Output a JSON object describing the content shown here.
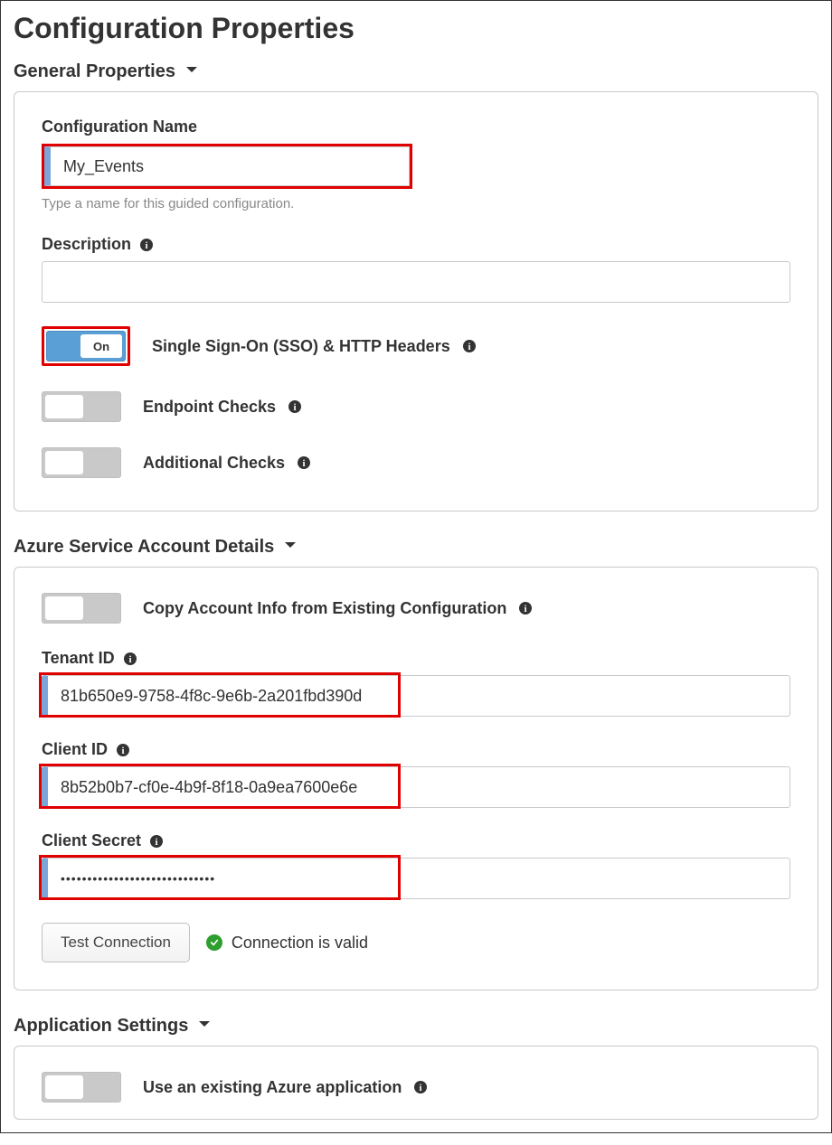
{
  "page": {
    "title": "Configuration Properties"
  },
  "sections": {
    "general": {
      "header": "General Properties",
      "fields": {
        "configName": {
          "label": "Configuration Name",
          "value": "My_Events",
          "helper": "Type a name for this guided configuration."
        },
        "description": {
          "label": "Description",
          "value": ""
        }
      },
      "toggles": {
        "sso": {
          "label": "Single Sign-On (SSO) & HTTP Headers",
          "on": true,
          "onText": "On"
        },
        "endpoint": {
          "label": "Endpoint Checks",
          "on": false
        },
        "additional": {
          "label": "Additional Checks",
          "on": false
        }
      }
    },
    "azure": {
      "header": "Azure Service Account Details",
      "toggles": {
        "copy": {
          "label": "Copy Account Info from Existing Configuration",
          "on": false
        }
      },
      "fields": {
        "tenantId": {
          "label": "Tenant ID",
          "value": "81b650e9-9758-4f8c-9e6b-2a201fbd390d"
        },
        "clientId": {
          "label": "Client ID",
          "value": "8b52b0b7-cf0e-4b9f-8f18-0a9ea7600e6e"
        },
        "clientSecret": {
          "label": "Client Secret",
          "value": "•••••••••••••••••••••••••••••"
        }
      },
      "testButton": "Test Connection",
      "statusText": "Connection is valid"
    },
    "appSettings": {
      "header": "Application Settings",
      "toggles": {
        "useExisting": {
          "label": "Use an existing Azure application",
          "on": false
        }
      }
    }
  }
}
